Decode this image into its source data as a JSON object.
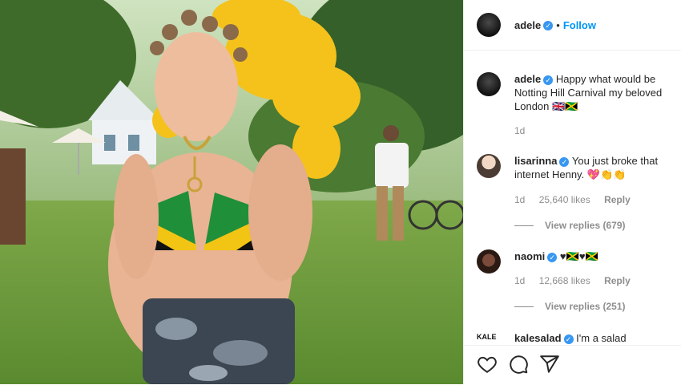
{
  "header": {
    "username": "adele",
    "separator": "•",
    "follow_label": "Follow"
  },
  "caption": {
    "username": "adele",
    "text": "Happy what would be Notting Hill Carnival my beloved London 🇬🇧🇯🇲",
    "time": "1d"
  },
  "comments": [
    {
      "username": "lisarinna",
      "text": "You just broke that internet Henny. 💖👏👏",
      "time": "1d",
      "likes": "25,640 likes",
      "reply_label": "Reply",
      "view_replies": "View replies (679)"
    },
    {
      "username": "naomi",
      "text": "♥🇯🇲♥🇯🇲",
      "time": "1d",
      "likes": "12,668 likes",
      "reply_label": "Reply",
      "view_replies": "View replies (251)"
    },
    {
      "username": "kalesalad",
      "avatar_text": "KALE",
      "text": "I'm a salad"
    }
  ],
  "actions": {
    "icons": [
      "heart-icon",
      "comment-icon",
      "share-icon"
    ]
  },
  "colors": {
    "link": "#0095f6",
    "verified": "#3897f0",
    "text": "#262626",
    "muted": "#8e8e8e"
  }
}
